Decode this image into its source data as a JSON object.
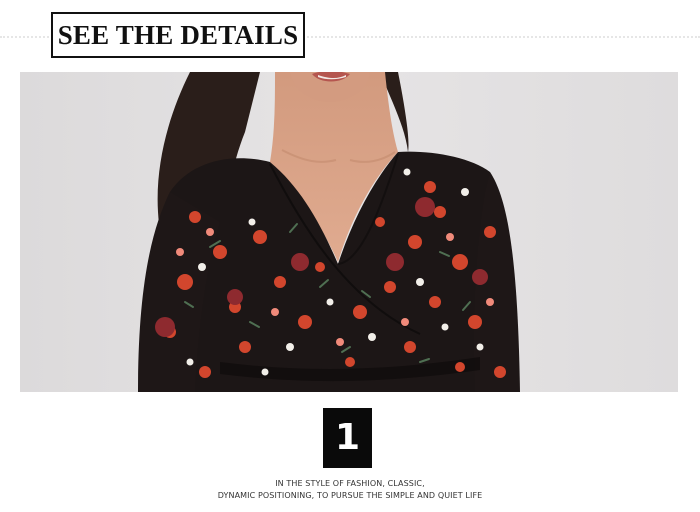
{
  "header": {
    "title": "SEE THE DETAILS"
  },
  "photo": {
    "subject": "model-wearing-floral-wrap-dress",
    "colors": {
      "background": "#e2e0e1",
      "dress": "#1c1616",
      "flower_red": "#d2462d",
      "flower_pink": "#f08a7a",
      "flower_white": "#f2efe9",
      "leaf": "#4f6f52",
      "skin": "#d9a285",
      "hair": "#2a1e1a"
    }
  },
  "badge": {
    "number": "1"
  },
  "caption": {
    "line1": "IN THE STYLE OF FASHION, CLASSIC,",
    "line2": "DYNAMIC POSITIONING, TO PURSUE THE SIMPLE AND QUIET LIFE"
  }
}
